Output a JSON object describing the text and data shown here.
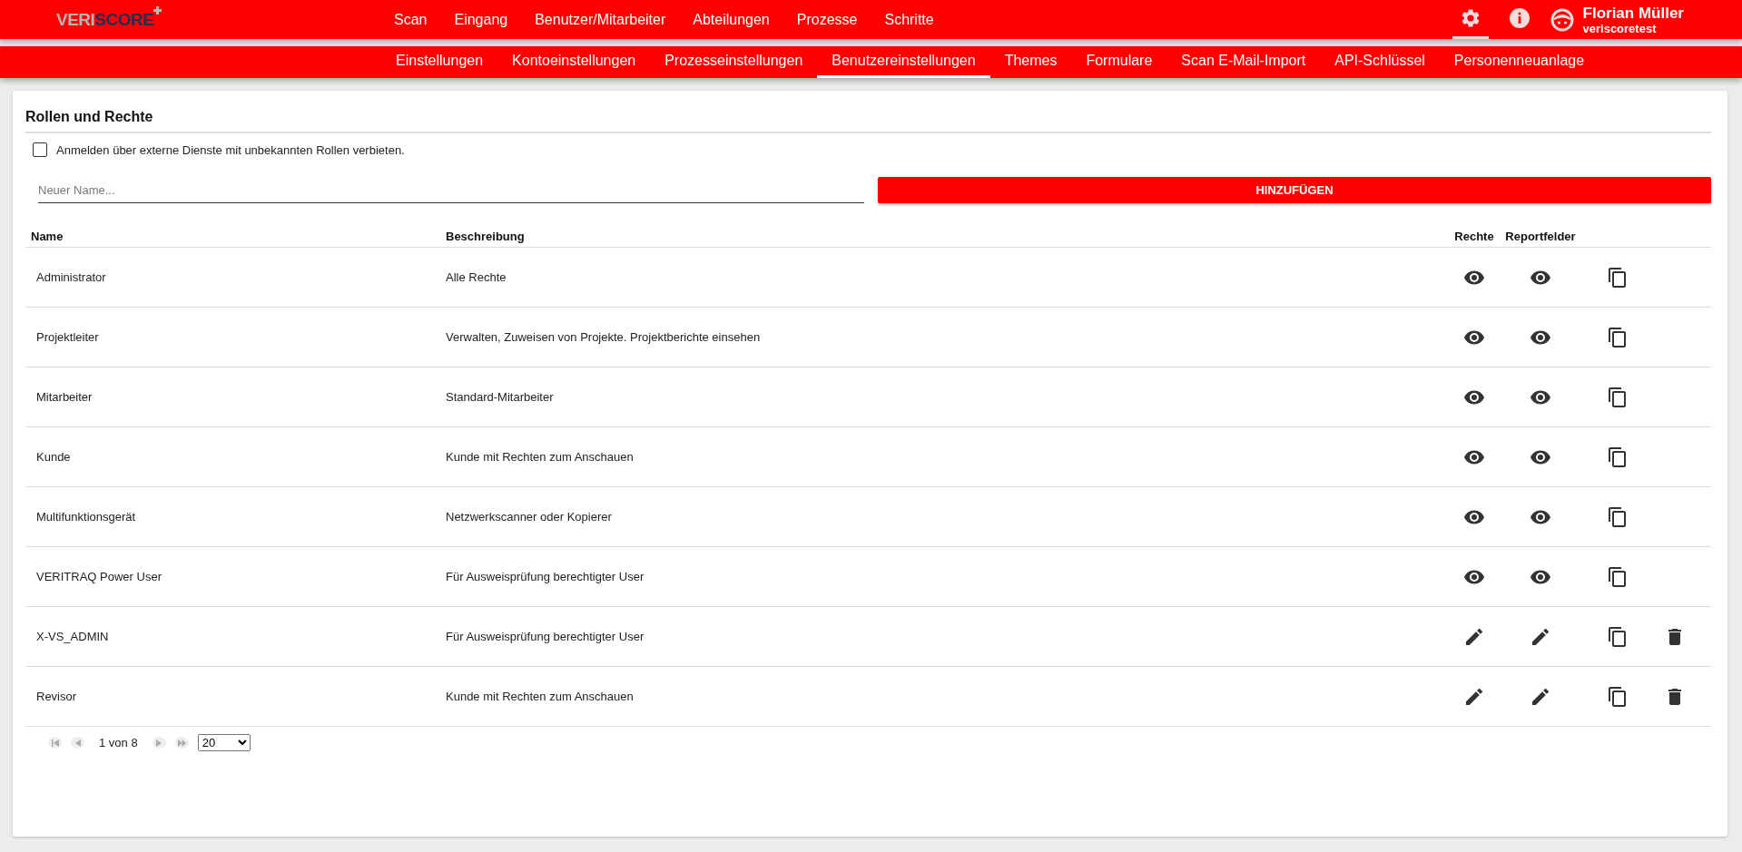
{
  "logo": {
    "light": "VERI",
    "dark": "SCORE"
  },
  "main_nav": [
    "Scan",
    "Eingang",
    "Benutzer/Mitarbeiter",
    "Abteilungen",
    "Prozesse",
    "Schritte"
  ],
  "toolbar": {
    "settings_selected": true
  },
  "user": {
    "name": "Florian Müller",
    "account": "veriscoretest"
  },
  "settings_tabs": [
    {
      "label": "Einstellungen",
      "selected": false
    },
    {
      "label": "Kontoeinstellungen",
      "selected": false
    },
    {
      "label": "Prozesseinstellungen",
      "selected": false
    },
    {
      "label": "Benutzereinstellungen",
      "selected": true
    },
    {
      "label": "Themes",
      "selected": false
    },
    {
      "label": "Formulare",
      "selected": false
    },
    {
      "label": "Scan E-Mail-Import",
      "selected": false
    },
    {
      "label": "API-Schlüssel",
      "selected": false
    },
    {
      "label": "Personenneuanlage",
      "selected": false
    }
  ],
  "section_title": "Rollen und Rechte",
  "external_login": {
    "label": "Anmelden über externe Dienste mit unbekannten Rollen verbieten.",
    "checked": false
  },
  "new_name": {
    "placeholder": "Neuer Name..."
  },
  "add_button": "HINZUFÜGEN",
  "table": {
    "columns": [
      "Name",
      "Beschreibung",
      "Rechte",
      "Reportfelder"
    ],
    "rows": [
      {
        "name": "Administrator",
        "description": "Alle Rechte",
        "kind": "view",
        "deletable": false
      },
      {
        "name": "Projektleiter",
        "description": "Verwalten, Zuweisen von Projekte. Projektberichte einsehen",
        "kind": "view",
        "deletable": false
      },
      {
        "name": "Mitarbeiter",
        "description": "Standard-Mitarbeiter",
        "kind": "view",
        "deletable": false
      },
      {
        "name": "Kunde",
        "description": "Kunde mit Rechten zum Anschauen",
        "kind": "view",
        "deletable": false
      },
      {
        "name": "Multifunktionsgerät",
        "description": "Netzwerkscanner oder Kopierer",
        "kind": "view",
        "deletable": false
      },
      {
        "name": "VERITRAQ Power User",
        "description": "Für Ausweisprüfung berechtigter User",
        "kind": "view",
        "deletable": false
      },
      {
        "name": "X-VS_ADMIN",
        "description": "Für Ausweisprüfung berechtigter User",
        "kind": "edit",
        "deletable": true
      },
      {
        "name": "Revisor",
        "description": "Kunde mit Rechten zum Anschauen",
        "kind": "edit",
        "deletable": true
      }
    ]
  },
  "pagination": {
    "page_info": "1 von 8",
    "page_size": "20"
  }
}
